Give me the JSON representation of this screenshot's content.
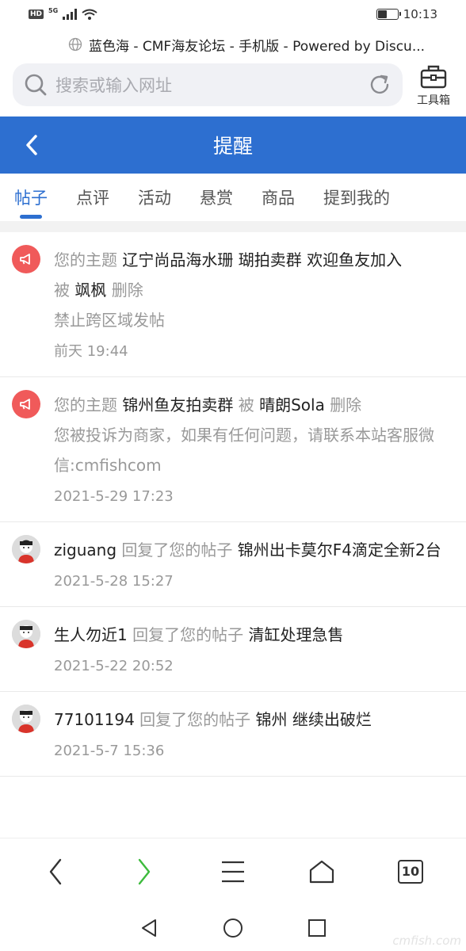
{
  "status_bar": {
    "hd": "HD",
    "network": "5G",
    "time": "10:13",
    "battery_level": 0.45
  },
  "browser": {
    "page_title": "蓝色海 - CMF海友论坛 - 手机版 - Powered by Discu...",
    "search_placeholder": "搜索或输入网址",
    "toolbox_label": "工具箱",
    "tab_count": "10"
  },
  "header": {
    "title": "提醒"
  },
  "tabs": [
    {
      "label": "帖子",
      "active": true
    },
    {
      "label": "点评"
    },
    {
      "label": "活动"
    },
    {
      "label": "悬赏"
    },
    {
      "label": "商品"
    },
    {
      "label": "提到我的"
    }
  ],
  "notifications": [
    {
      "icon": "megaphone-icon",
      "prefix": "您的主题",
      "subject": "辽宁尚品海水珊 瑚拍卖群 欢迎鱼友加入",
      "by": "被",
      "actor": "飒枫",
      "action": "删除",
      "note": "禁止跨区域发帖",
      "time": "前天 19:44"
    },
    {
      "icon": "megaphone-icon",
      "prefix": "您的主题",
      "subject": "锦州鱼友拍卖群",
      "by": "被",
      "actor": "晴朗Sola",
      "action": "删除",
      "note": "您被投诉为商家，如果有任何问题，请联系本站客服微信:cmfishcom",
      "time": "2021-5-29 17:23"
    },
    {
      "icon": "avatar-icon",
      "user": "ziguang",
      "action": "回复了您的帖子",
      "subject": "锦州出卡莫尔F4滴定全新2台",
      "time": "2021-5-28 15:27"
    },
    {
      "icon": "avatar-icon",
      "user": "生人勿近1",
      "action": "回复了您的帖子",
      "subject": "清缸处理急售",
      "time": "2021-5-22 20:52"
    },
    {
      "icon": "avatar-icon",
      "user": "77101194",
      "action": "回复了您的帖子",
      "subject": "锦州 继续出破烂",
      "time": "2021-5-7 15:36"
    }
  ],
  "watermark": "cmfish.com",
  "colors": {
    "brand": "#2d6fd0",
    "alert": "#f05a5a",
    "forward_green": "#3dbb3d"
  }
}
